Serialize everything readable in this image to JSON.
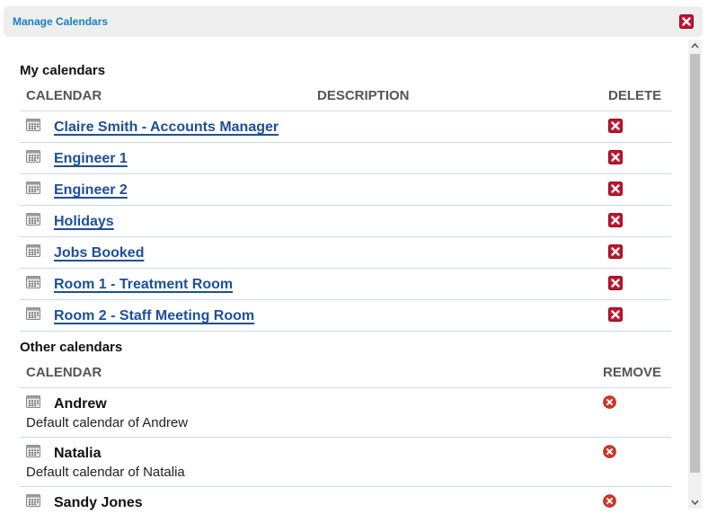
{
  "dialog": {
    "title": "Manage Calendars"
  },
  "my_calendars": {
    "title": "My calendars",
    "headers": {
      "calendar": "CALENDAR",
      "description": "DESCRIPTION",
      "delete": "DELETE"
    },
    "rows": [
      {
        "name": "Claire Smith - Accounts Manager"
      },
      {
        "name": "Engineer 1"
      },
      {
        "name": "Engineer 2"
      },
      {
        "name": "Holidays"
      },
      {
        "name": "Jobs Booked"
      },
      {
        "name": "Room 1 - Treatment Room"
      },
      {
        "name": "Room 2 - Staff Meeting Room"
      }
    ]
  },
  "other_calendars": {
    "title": "Other calendars",
    "headers": {
      "calendar": "CALENDAR",
      "remove": "REMOVE"
    },
    "rows": [
      {
        "name": "Andrew",
        "description": "Default calendar of Andrew"
      },
      {
        "name": "Natalia",
        "description": "Default calendar of Natalia"
      },
      {
        "name": "Sandy Jones",
        "description": ""
      }
    ]
  },
  "colors": {
    "link": "#1d4f9a",
    "title": "#1a7fb8",
    "delete": "#c0152e",
    "remove": "#d23a2a",
    "divider": "#c8dbe8"
  },
  "icons": {
    "close": "close-icon",
    "calendar": "calendar-icon",
    "delete": "delete-icon",
    "remove": "remove-icon"
  }
}
